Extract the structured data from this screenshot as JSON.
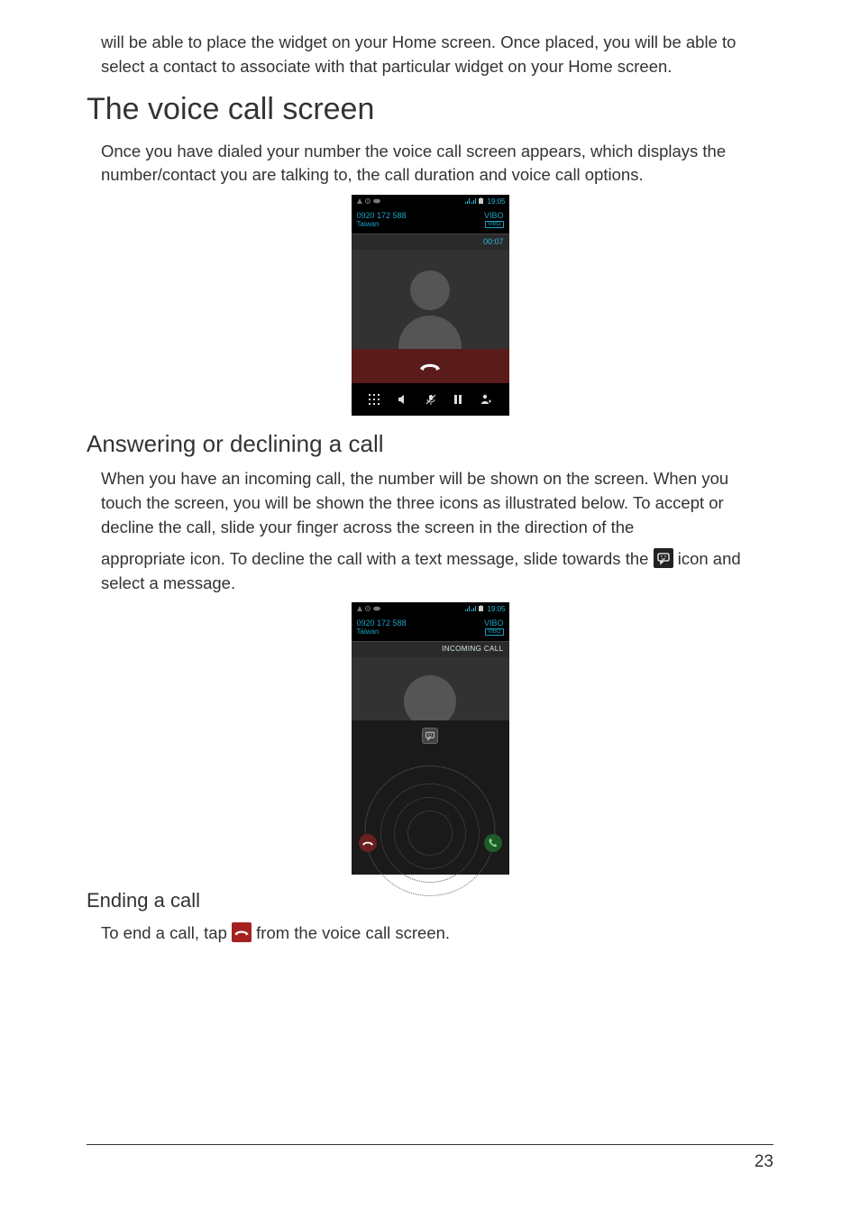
{
  "intro_para": "will be able to place the widget on your Home screen. Once placed, you will be able to select a contact to associate with that particular widget on your Home screen.",
  "h1_voice": "The voice call screen",
  "voice_para": "Once you have dialed your number the voice call screen appears, which displays the number/contact you are talking to, the call duration and voice call options.",
  "h2_answer": "Answering or declining a call",
  "answer_para1": "When you have an incoming call, the number will be shown on the screen. When you touch the screen, you will be shown the three icons as illustrated below. To accept or decline the call, slide your finger across the screen in the direction of the",
  "answer_para2_pre": "appropriate icon. To decline the call with a text message, slide towards the ",
  "answer_para2_post": " icon and select a message.",
  "h3_ending": "Ending a call",
  "ending_pre": "To end a call, tap ",
  "ending_post": " from the voice call screen.",
  "page_number": "23",
  "screenshot1": {
    "status_time": "19:05",
    "phone_number": "0920 172 588",
    "location": "Taiwan",
    "carrier": "VIBO",
    "carrier_badge": "VIBO",
    "duration": "00:07"
  },
  "screenshot2": {
    "status_time": "19:05",
    "phone_number": "0920 172 588",
    "location": "Taiwan",
    "carrier": "VIBO",
    "carrier_badge": "VIBO",
    "incoming_label": "INCOMING CALL"
  }
}
